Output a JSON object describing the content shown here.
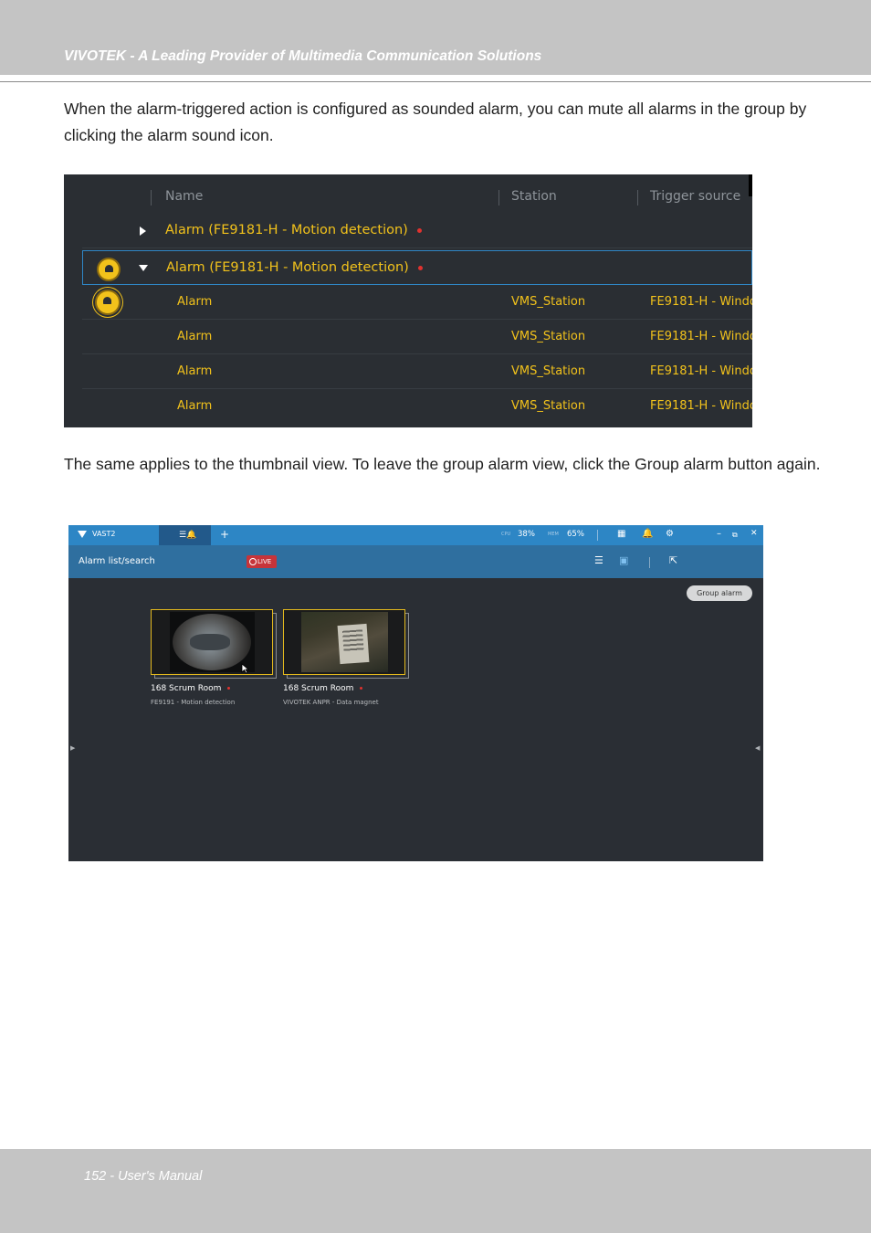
{
  "header": {
    "title": "VIVOTEK - A Leading Provider of Multimedia Communication Solutions"
  },
  "paragraphs": [
    "When the alarm-triggered action is configured as sounded alarm, you can mute all alarms in the group by clicking the alarm sound icon.",
    "The same applies to the thumbnail view. To leave the group alarm view, click the Group alarm button again."
  ],
  "alarm_table": {
    "columns": [
      "Name",
      "Station",
      "Trigger source"
    ],
    "groups": [
      {
        "name": "Alarm (FE9181-H - Motion detection)",
        "expanded": false
      },
      {
        "name": "Alarm (FE9181-H - Motion detection)",
        "expanded": true
      }
    ],
    "rows": [
      {
        "name": "Alarm",
        "station": "VMS_Station",
        "trigger": "FE9181-H - Windo..."
      },
      {
        "name": "Alarm",
        "station": "VMS_Station",
        "trigger": "FE9181-H - Windo..."
      },
      {
        "name": "Alarm",
        "station": "VMS_Station",
        "trigger": "FE9181-H - Windo..."
      },
      {
        "name": "Alarm",
        "station": "VMS_Station",
        "trigger": "FE9181-H - Windo..."
      }
    ],
    "colors": {
      "accent": "#f2c21b",
      "selection": "#2f86c6",
      "alert_dot": "#e0322f"
    }
  },
  "vast": {
    "app_name": "VAST2",
    "add_tab": "+",
    "cpu_label": "CPU",
    "cpu_value": "38%",
    "mem_label": "MEM",
    "mem_value": "65%",
    "page_title": "Alarm list/search",
    "live_badge": "LIVE",
    "group_alarm_button": "Group alarm",
    "thumbnails": [
      {
        "title": "168 Scrum Room",
        "subtitle": "FE9191 - Motion detection"
      },
      {
        "title": "168 Scrum Room",
        "subtitle": "VIVOTEK ANPR - Data magnet"
      }
    ],
    "icons": [
      "vivotek-logo-icon",
      "alarm-tab-icon",
      "grid-icon",
      "bell-icon",
      "gear-icon",
      "minimize-icon",
      "restore-icon",
      "close-icon",
      "list-view-icon",
      "thumbnail-view-icon",
      "export-icon"
    ],
    "colors": {
      "topbar": "#2d86c5",
      "subbar": "#2f6f9f",
      "live": "#c7343a",
      "frame": "#e2b81d"
    }
  },
  "footer": {
    "page_label": "152 - User's Manual"
  }
}
